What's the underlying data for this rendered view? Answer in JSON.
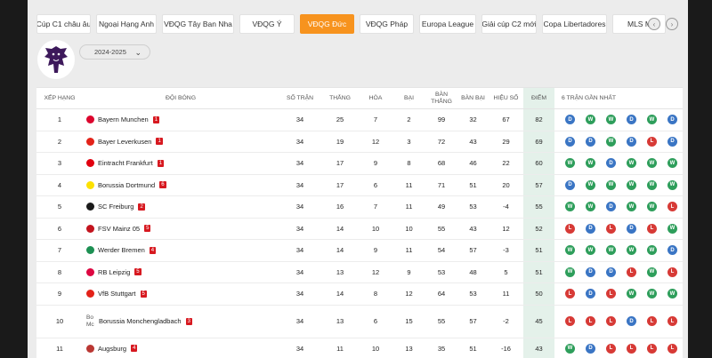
{
  "tabs": [
    {
      "label": "Cúp C1 châu âu",
      "active": false
    },
    {
      "label": "Ngoại Hạng Anh",
      "active": false
    },
    {
      "label": "VĐQG Tây Ban Nha",
      "active": false
    },
    {
      "label": "VĐQG Ý",
      "active": false
    },
    {
      "label": "VĐQG Đức",
      "active": true
    },
    {
      "label": "VĐQG Pháp",
      "active": false
    },
    {
      "label": "Europa League",
      "active": false
    },
    {
      "label": "Giải cúp C2 mới",
      "active": false
    },
    {
      "label": "Copa Libertadores",
      "active": false
    },
    {
      "label": "MLS M",
      "active": false
    }
  ],
  "nav": {
    "prev": "‹",
    "next": "›"
  },
  "season": {
    "label": "2024-2025",
    "caret": "⌄"
  },
  "headers": {
    "rank": "XẾP HẠNG",
    "team": "ĐỘI BÓNG",
    "played": "SỐ TRẬN",
    "won": "THẮNG",
    "drawn": "HÒA",
    "lost": "BẠI",
    "gf": "BÀN THẮNG",
    "ga": "BÀN BẠI",
    "gd": "HIỆU SỐ",
    "pts": "ĐIỂM",
    "form": "6 TRẬN GẦN NHẤT"
  },
  "rows": [
    {
      "rank": "1",
      "team": "Bayern Munchen",
      "rc": "1",
      "played": "34",
      "won": "25",
      "drawn": "7",
      "lost": "2",
      "gf": "99",
      "ga": "32",
      "gd": "67",
      "pts": "82",
      "form": [
        "D",
        "W",
        "W",
        "D",
        "W",
        "D",
        "?"
      ],
      "crest": "#dc052d"
    },
    {
      "rank": "2",
      "team": "Bayer Leverkusen",
      "rc": "1",
      "played": "34",
      "won": "19",
      "drawn": "12",
      "lost": "3",
      "gf": "72",
      "ga": "43",
      "gd": "29",
      "pts": "69",
      "form": [
        "D",
        "D",
        "W",
        "D",
        "L",
        "D",
        "?"
      ],
      "crest": "#e32219"
    },
    {
      "rank": "3",
      "team": "Eintracht Frankfurt",
      "rc": "1",
      "played": "34",
      "won": "17",
      "drawn": "9",
      "lost": "8",
      "gf": "68",
      "ga": "46",
      "gd": "22",
      "pts": "60",
      "form": [
        "W",
        "W",
        "D",
        "W",
        "W",
        "W",
        "?"
      ],
      "crest": "#e1000f"
    },
    {
      "rank": "4",
      "team": "Borussia Dortmund",
      "rc": "6",
      "played": "34",
      "won": "17",
      "drawn": "6",
      "lost": "11",
      "gf": "71",
      "ga": "51",
      "gd": "20",
      "pts": "57",
      "form": [
        "D",
        "W",
        "W",
        "W",
        "W",
        "W",
        "?"
      ],
      "crest": "#fde100"
    },
    {
      "rank": "5",
      "team": "SC Freiburg",
      "rc": "2",
      "played": "34",
      "won": "16",
      "drawn": "7",
      "lost": "11",
      "gf": "49",
      "ga": "53",
      "gd": "-4",
      "pts": "55",
      "form": [
        "W",
        "W",
        "D",
        "W",
        "W",
        "L",
        "?"
      ],
      "crest": "#1a1a1a"
    },
    {
      "rank": "6",
      "team": "FSV Mainz 05",
      "rc": "5",
      "played": "34",
      "won": "14",
      "drawn": "10",
      "lost": "10",
      "gf": "55",
      "ga": "43",
      "gd": "12",
      "pts": "52",
      "form": [
        "L",
        "D",
        "L",
        "D",
        "L",
        "W",
        "?"
      ],
      "crest": "#c3141e"
    },
    {
      "rank": "7",
      "team": "Werder Bremen",
      "rc": "4",
      "played": "34",
      "won": "14",
      "drawn": "9",
      "lost": "11",
      "gf": "54",
      "ga": "57",
      "gd": "-3",
      "pts": "51",
      "form": [
        "W",
        "W",
        "W",
        "W",
        "W",
        "D",
        "?"
      ],
      "crest": "#1d9053"
    },
    {
      "rank": "8",
      "team": "RB Leipzig",
      "rc": "5",
      "played": "34",
      "won": "13",
      "drawn": "12",
      "lost": "9",
      "gf": "53",
      "ga": "48",
      "gd": "5",
      "pts": "51",
      "form": [
        "W",
        "D",
        "D",
        "L",
        "W",
        "L",
        "?"
      ],
      "crest": "#dd0741"
    },
    {
      "rank": "9",
      "team": "VfB Stuttgart",
      "rc": "5",
      "played": "34",
      "won": "14",
      "drawn": "8",
      "lost": "12",
      "gf": "64",
      "ga": "53",
      "gd": "11",
      "pts": "50",
      "form": [
        "L",
        "D",
        "L",
        "W",
        "W",
        "W",
        "?"
      ],
      "crest": "#e32219"
    },
    {
      "rank": "10",
      "team": "Borussia Monchengladbach",
      "rc": "3",
      "played": "34",
      "won": "13",
      "drawn": "6",
      "lost": "15",
      "gf": "55",
      "ga": "57",
      "gd": "-2",
      "pts": "45",
      "form": [
        "L",
        "L",
        "L",
        "D",
        "L",
        "L",
        "?"
      ],
      "crest": "",
      "broken_crest": [
        "Bo",
        "Mc"
      ]
    },
    {
      "rank": "11",
      "team": "Augsburg",
      "rc": "4",
      "played": "34",
      "won": "11",
      "drawn": "10",
      "lost": "13",
      "gf": "35",
      "ga": "51",
      "gd": "-16",
      "pts": "43",
      "form": [
        "W",
        "D",
        "L",
        "L",
        "L",
        "L",
        "?"
      ],
      "crest": "#ba3733"
    }
  ]
}
